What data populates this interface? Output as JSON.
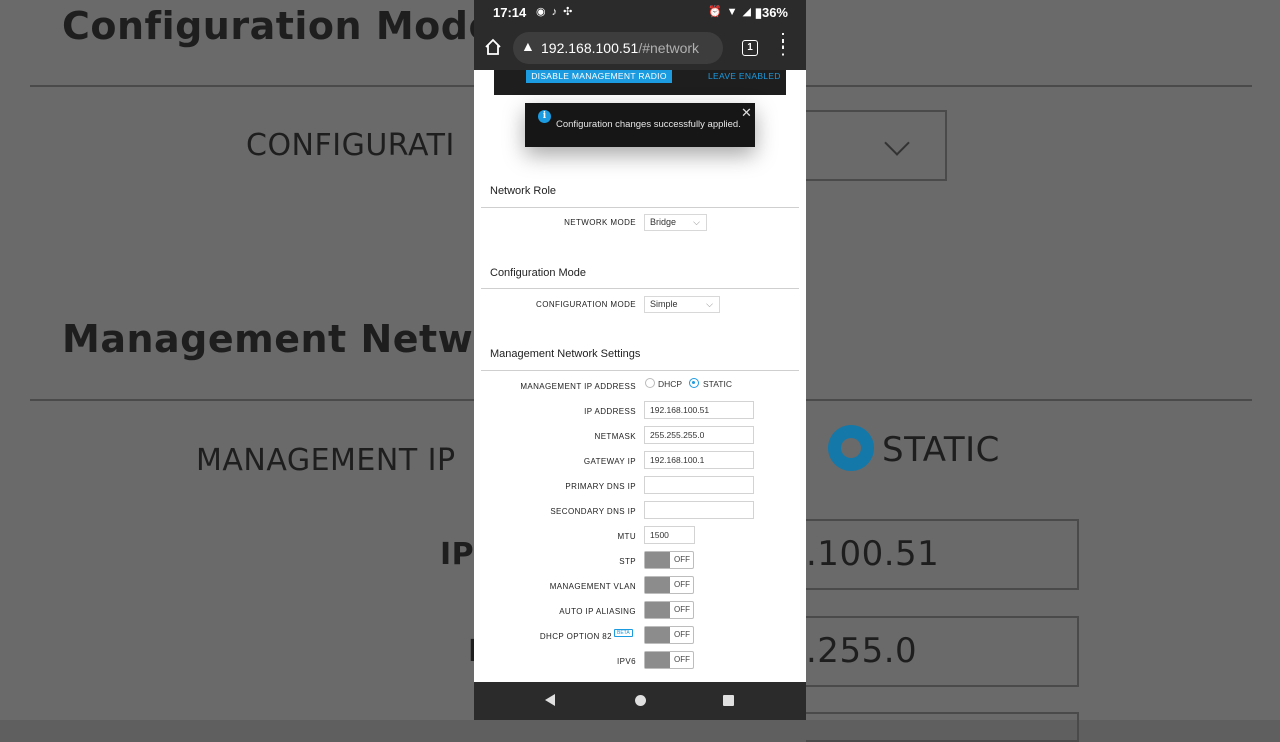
{
  "background": {
    "config_mode_heading": "Configuration Mode",
    "configuration_label": "CONFIGURATI",
    "mgmt_network_heading": "Management Networ",
    "mgmt_ip_label": "MANAGEMENT IP",
    "static_label": "STATIC",
    "ip_label": "IP",
    "netmask_fragment": "N",
    "ip_value_fragment": ".100.51",
    "netmask_value_fragment": ".255.0"
  },
  "status_bar": {
    "time": "17:14",
    "battery": "36%",
    "left_icons": [
      "notification-icon",
      "tiktok-icon",
      "settings-icon"
    ],
    "right_icons": [
      "alarm-icon",
      "wifi-icon",
      "signal-icon",
      "battery-icon"
    ]
  },
  "browser": {
    "url_host": "192.168.100.51",
    "url_path": "/#network",
    "tab_count": "1"
  },
  "banner": {
    "disable_label": "DISABLE MANAGEMENT RADIO",
    "leave_label": "LEAVE ENABLED"
  },
  "toast": {
    "message": "Configuration changes successfully applied."
  },
  "network_role": {
    "title": "Network Role",
    "network_mode_label": "NETWORK MODE",
    "network_mode_value": "Bridge"
  },
  "configuration_mode": {
    "title": "Configuration Mode",
    "label": "CONFIGURATION MODE",
    "value": "Simple"
  },
  "management": {
    "title": "Management Network Settings",
    "ip_address_mode_label": "MANAGEMENT IP ADDRESS",
    "dhcp_label": "DHCP",
    "static_label": "STATIC",
    "selected_mode": "STATIC",
    "ip_address_label": "IP ADDRESS",
    "ip_address": "192.168.100.51",
    "netmask_label": "NETMASK",
    "netmask": "255.255.255.0",
    "gateway_label": "GATEWAY IP",
    "gateway": "192.168.100.1",
    "primary_dns_label": "PRIMARY DNS IP",
    "primary_dns": "",
    "secondary_dns_label": "SECONDARY DNS IP",
    "secondary_dns": "",
    "mtu_label": "MTU",
    "mtu": "1500",
    "stp_label": "STP",
    "stp_state": "OFF",
    "vlan_label": "MANAGEMENT VLAN",
    "vlan_state": "OFF",
    "aliasing_label": "AUTO IP ALIASING",
    "aliasing_state": "OFF",
    "dhcp82_label": "DHCP OPTION 82",
    "beta_badge": "BETA",
    "dhcp82_state": "OFF",
    "ipv6_label": "IPV6",
    "ipv6_state": "OFF"
  },
  "colors": {
    "accent": "#1c9be0",
    "toggle_off": "#8c8c8c"
  }
}
